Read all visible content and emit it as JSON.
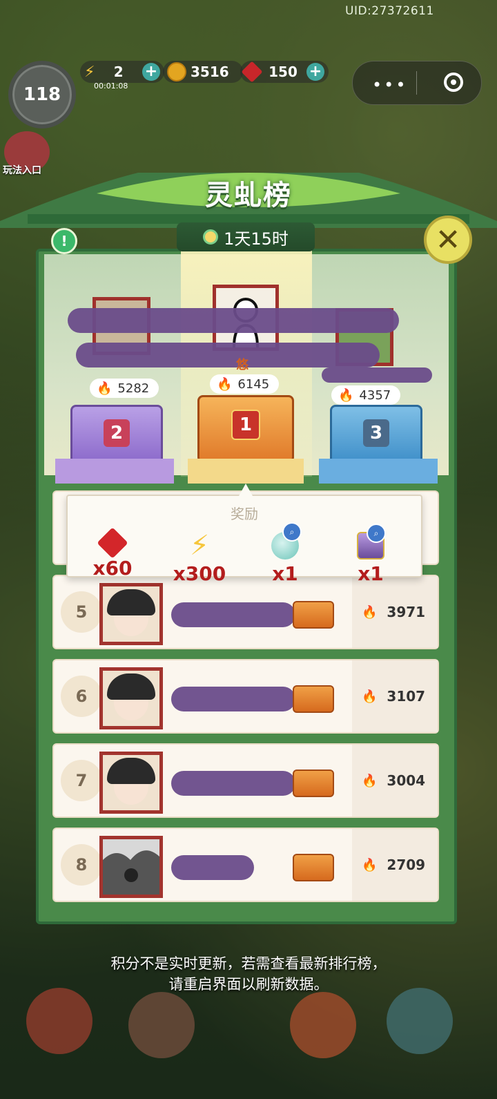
{
  "status": {
    "uid": "UID:27372611",
    "level": "118",
    "energy": "2",
    "energy_timer": "00:01:08",
    "coins": "3516",
    "gems": "150"
  },
  "side": {
    "gameplay_entry": "玩法入口"
  },
  "modal": {
    "title": "灵虬榜",
    "countdown": "1天15时",
    "close": "✕",
    "info": "!"
  },
  "podium": [
    {
      "rank": "2",
      "score": "5282"
    },
    {
      "rank": "1",
      "score": "6145",
      "name_char": "悠"
    },
    {
      "rank": "3",
      "score": "4357"
    }
  ],
  "reward_popup": {
    "title": "奖励",
    "items": [
      {
        "icon": "ruby-icon",
        "qty": "x60"
      },
      {
        "icon": "energy-bolt-icon",
        "qty": "x300"
      },
      {
        "icon": "jade-cloud-icon",
        "qty": "x1"
      },
      {
        "icon": "treasure-chest-icon",
        "qty": "x1"
      }
    ]
  },
  "leaderboard": [
    {
      "rank": "5",
      "score": "3971"
    },
    {
      "rank": "6",
      "score": "3107"
    },
    {
      "rank": "7",
      "score": "3004"
    },
    {
      "rank": "8",
      "score": "2709"
    }
  ],
  "footer_note_line1": "积分不是实时更新，若需查看最新排行榜，",
  "footer_note_line2": "请重启界面以刷新数据。",
  "colors": {
    "frame_green": "#4a8a4a",
    "title_green": "#2c5b2c",
    "rank1_orange": "#e07a2a",
    "rank2_purple": "#8c6acb",
    "rank3_blue": "#3f8fc9",
    "reward_red": "#b31d1d"
  }
}
